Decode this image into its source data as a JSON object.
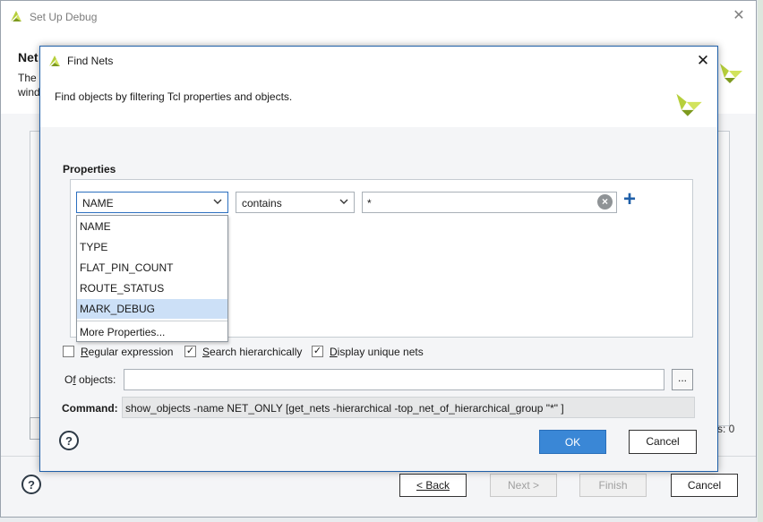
{
  "background_window": {
    "title": "Set Up Debug",
    "heading": "Net",
    "desc_line1": "The",
    "desc_line2": "wind",
    "right_label": "s: 0",
    "buttons": {
      "back": "< Back",
      "next": "Next >",
      "finish": "Finish",
      "cancel": "Cancel"
    },
    "help": "?"
  },
  "dialog": {
    "title": "Find Nets",
    "description": "Find objects by filtering Tcl properties and objects.",
    "properties_label": "Properties",
    "property_combo": "NAME",
    "operator_combo": "contains",
    "value": "*",
    "dropdown_items": [
      "NAME",
      "TYPE",
      "FLAT_PIN_COUNT",
      "ROUTE_STATUS",
      "MARK_DEBUG"
    ],
    "dropdown_selected": "MARK_DEBUG",
    "dropdown_more": "More Properties...",
    "checkboxes": {
      "regular_expression": {
        "label": "Regular expression",
        "checked": false
      },
      "search_hierarchically": {
        "label": "Search hierarchically",
        "checked": true
      },
      "display_unique_nets": {
        "label": "Display unique nets",
        "checked": true
      }
    },
    "of_objects_label": "Of objects:",
    "of_objects_value": "",
    "browse_label": "...",
    "command_label": "Command:",
    "command_text": "show_objects -name NET_ONLY [get_nets -hierarchical -top_net_of_hierarchical_group \"*\" ]",
    "ok": "OK",
    "cancel": "Cancel",
    "help": "?"
  },
  "colors": {
    "accent": "#3a87d6",
    "logo_green": "#b6cf3b",
    "selection": "#cce0f7"
  }
}
